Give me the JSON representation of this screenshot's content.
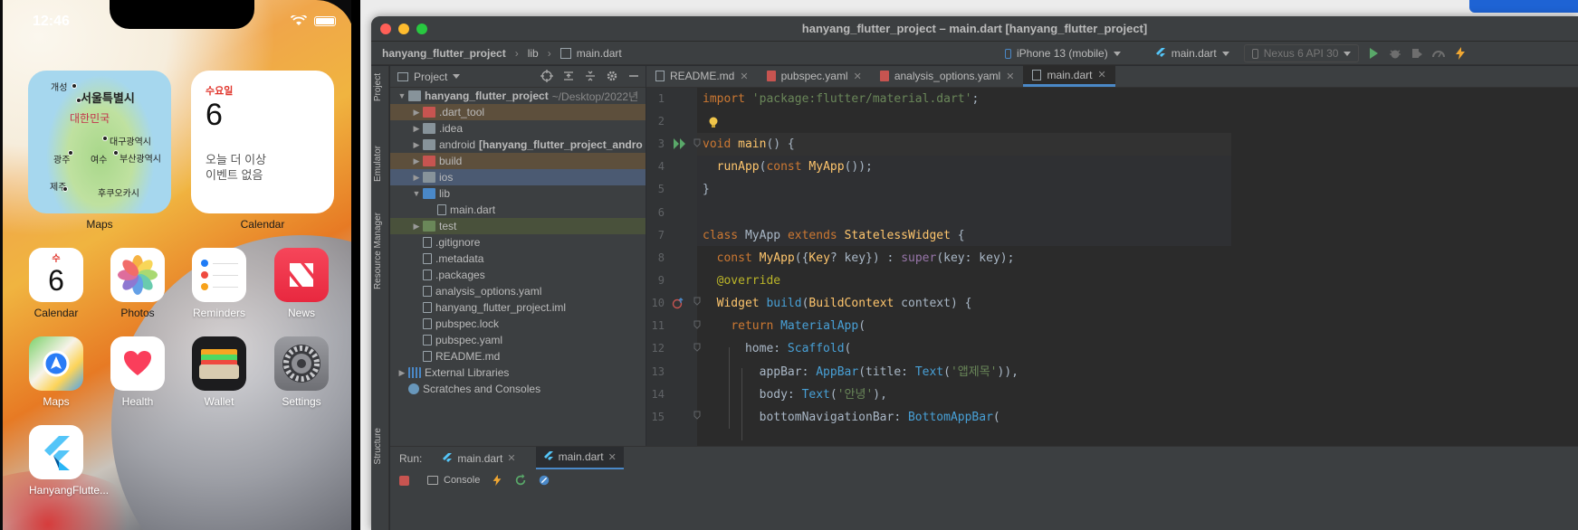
{
  "phone": {
    "time": "12:46",
    "widgets": {
      "maps": {
        "label": "Maps",
        "places": {
          "gaesong": "개성",
          "seoul": "서울특별시",
          "korea": "대한민국",
          "daegu": "대구광역시",
          "gwangju": "광주",
          "yeosu": "여수",
          "busan": "부산광역시",
          "jeju": "제주",
          "fukuoka": "후쿠오카시"
        }
      },
      "calendar": {
        "label": "Calendar",
        "weekday": "수요일",
        "day": "6",
        "note": "오늘 더 이상\n이벤트 없음"
      }
    },
    "apps": [
      {
        "name": "Calendar",
        "weekday": "수",
        "day": "6"
      },
      {
        "name": "Photos"
      },
      {
        "name": "Reminders"
      },
      {
        "name": "News"
      },
      {
        "name": "Maps"
      },
      {
        "name": "Health"
      },
      {
        "name": "Wallet"
      },
      {
        "name": "Settings"
      },
      {
        "name": "HanyangFlutte..."
      }
    ]
  },
  "ide": {
    "window_title": "hanyang_flutter_project – main.dart [hanyang_flutter_project]",
    "breadcrumb": [
      "hanyang_flutter_project",
      "lib",
      "main.dart"
    ],
    "device_selector": "iPhone 13 (mobile)",
    "run_config": "main.dart",
    "emulator_selector": "Nexus 6 API 30",
    "side_tabs": [
      "Project",
      "Emulator",
      "Resource Manager",
      "Structure"
    ],
    "project_panel": {
      "title": "Project",
      "tree": [
        {
          "label": "hanyang_flutter_project",
          "hint": "~/Desktop/2022년",
          "level": 0,
          "arrow": "down",
          "kind": "folder"
        },
        {
          "label": ".dart_tool",
          "level": 1,
          "arrow": "right",
          "kind": "folder-red",
          "style": "excluded"
        },
        {
          "label": ".idea",
          "level": 1,
          "arrow": "right",
          "kind": "folder"
        },
        {
          "label": "android",
          "suffix": "[hanyang_flutter_project_andro",
          "level": 1,
          "arrow": "right",
          "kind": "folder"
        },
        {
          "label": "build",
          "level": 1,
          "arrow": "right",
          "kind": "folder-red",
          "style": "excluded"
        },
        {
          "label": "ios",
          "level": 1,
          "arrow": "right",
          "kind": "folder",
          "style": "selected"
        },
        {
          "label": "lib",
          "level": 1,
          "arrow": "down",
          "kind": "folder-blue"
        },
        {
          "label": "main.dart",
          "level": 2,
          "arrow": "",
          "kind": "file"
        },
        {
          "label": "test",
          "level": 1,
          "arrow": "right",
          "kind": "folder-green",
          "style": "test"
        },
        {
          "label": ".gitignore",
          "level": 1,
          "arrow": "",
          "kind": "file"
        },
        {
          "label": ".metadata",
          "level": 1,
          "arrow": "",
          "kind": "file"
        },
        {
          "label": ".packages",
          "level": 1,
          "arrow": "",
          "kind": "file"
        },
        {
          "label": "analysis_options.yaml",
          "level": 1,
          "arrow": "",
          "kind": "file"
        },
        {
          "label": "hanyang_flutter_project.iml",
          "level": 1,
          "arrow": "",
          "kind": "file"
        },
        {
          "label": "pubspec.lock",
          "level": 1,
          "arrow": "",
          "kind": "file"
        },
        {
          "label": "pubspec.yaml",
          "level": 1,
          "arrow": "",
          "kind": "file"
        },
        {
          "label": "README.md",
          "level": 1,
          "arrow": "",
          "kind": "file"
        },
        {
          "label": "External Libraries",
          "level": 0,
          "arrow": "right",
          "kind": "lib"
        },
        {
          "label": "Scratches and Consoles",
          "level": 0,
          "arrow": "",
          "kind": "scratch"
        }
      ]
    },
    "editor_tabs": [
      {
        "label": "README.md",
        "active": false
      },
      {
        "label": "pubspec.yaml",
        "active": false
      },
      {
        "label": "analysis_options.yaml",
        "active": false
      },
      {
        "label": "main.dart",
        "active": true
      }
    ],
    "line_numbers": [
      "1",
      "2",
      "3",
      "4",
      "5",
      "6",
      "7",
      "8",
      "9",
      "10",
      "11",
      "12",
      "13",
      "14",
      "15"
    ],
    "run_panel": {
      "label": "Run:",
      "tabs": [
        "main.dart",
        "main.dart"
      ],
      "console_label": "Console"
    },
    "colors": {
      "accent": "#4a88c7",
      "run_green": "#59a869",
      "keyword": "#cc7832",
      "string": "#6a8759"
    }
  }
}
